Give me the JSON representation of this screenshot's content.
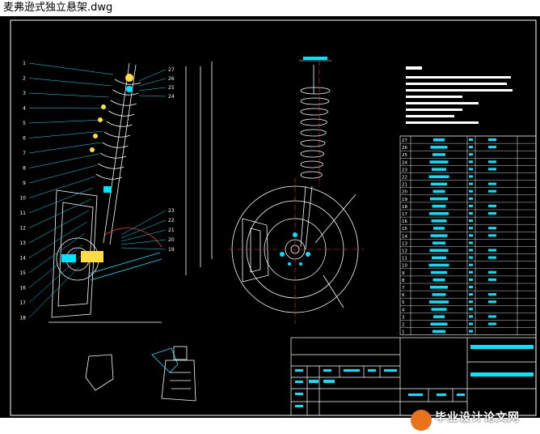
{
  "window": {
    "title": "麦弗逊式独立悬架.dwg"
  },
  "colors": {
    "background": "#000000",
    "linework": "#ffffff",
    "accent": "#00e5ff",
    "part": "#ffdd44",
    "centerline": "#ff3030",
    "frame": "#ffffff"
  },
  "drawing": {
    "part_numbers_left": [
      "1",
      "2",
      "3",
      "4",
      "5",
      "6",
      "7",
      "8",
      "9",
      "10",
      "11",
      "12",
      "13",
      "14",
      "15",
      "16",
      "17",
      "18"
    ],
    "part_numbers_right": [
      "27",
      "26",
      "25",
      "24",
      "23",
      "22",
      "21",
      "20",
      "19"
    ],
    "bom_rows": [
      "27",
      "26",
      "25",
      "24",
      "23",
      "22",
      "21",
      "20",
      "19",
      "18",
      "17",
      "16",
      "15",
      "14",
      "13",
      "12",
      "11",
      "10",
      "9",
      "8",
      "7",
      "6",
      "5",
      "4",
      "3",
      "2",
      "1"
    ]
  },
  "watermark": {
    "text": "毕业设计论文网",
    "url": "www.56doc.com"
  }
}
